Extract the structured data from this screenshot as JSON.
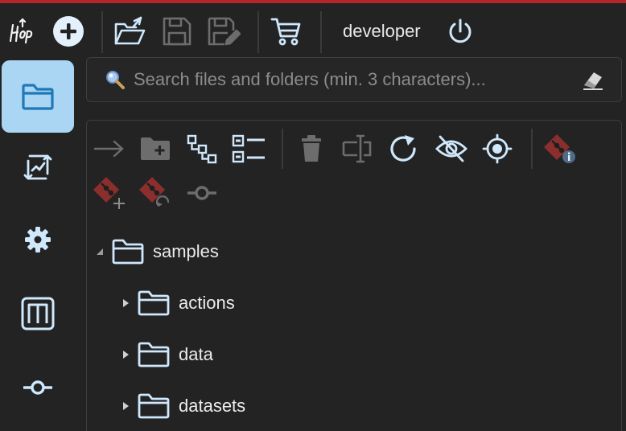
{
  "app": {
    "name": "Hop"
  },
  "toolbar": {
    "user": "developer",
    "icons": [
      "hop-logo-icon",
      "new-plus-icon",
      "open-folder-icon",
      "save-icon",
      "save-as-icon",
      "marketplace-cart-icon",
      "power-logout-icon"
    ]
  },
  "sidebar": {
    "items": [
      {
        "id": "explorer",
        "icon": "folder-icon",
        "active": true
      },
      {
        "id": "execution",
        "icon": "execution-arrows-icon",
        "active": false
      },
      {
        "id": "configuration",
        "icon": "gear-icon",
        "active": false
      },
      {
        "id": "metadata",
        "icon": "metadata-m-icon",
        "active": false
      },
      {
        "id": "git",
        "icon": "git-commit-icon",
        "active": false
      }
    ]
  },
  "search": {
    "placeholder": "Search files and folders (min. 3 characters)...",
    "value": ""
  },
  "explorer_toolbar": {
    "icons": [
      "open-arrow-icon",
      "new-folder-icon",
      "expand-tree-icon",
      "collapse-list-icon",
      "delete-icon",
      "rename-icon",
      "refresh-icon",
      "hide-icon",
      "select-target-icon",
      "git-info-icon",
      "git-add-icon",
      "git-revert-icon",
      "git-commit-icon"
    ]
  },
  "tree": {
    "root": {
      "label": "samples",
      "expanded": true
    },
    "children": [
      {
        "label": "actions"
      },
      {
        "label": "data"
      },
      {
        "label": "datasets"
      }
    ]
  },
  "colors": {
    "background": "#232323",
    "accent": "#aad6f3",
    "icon": "#cfe8fb",
    "git": "#8a2e2e",
    "top_line": "#b3262a"
  }
}
